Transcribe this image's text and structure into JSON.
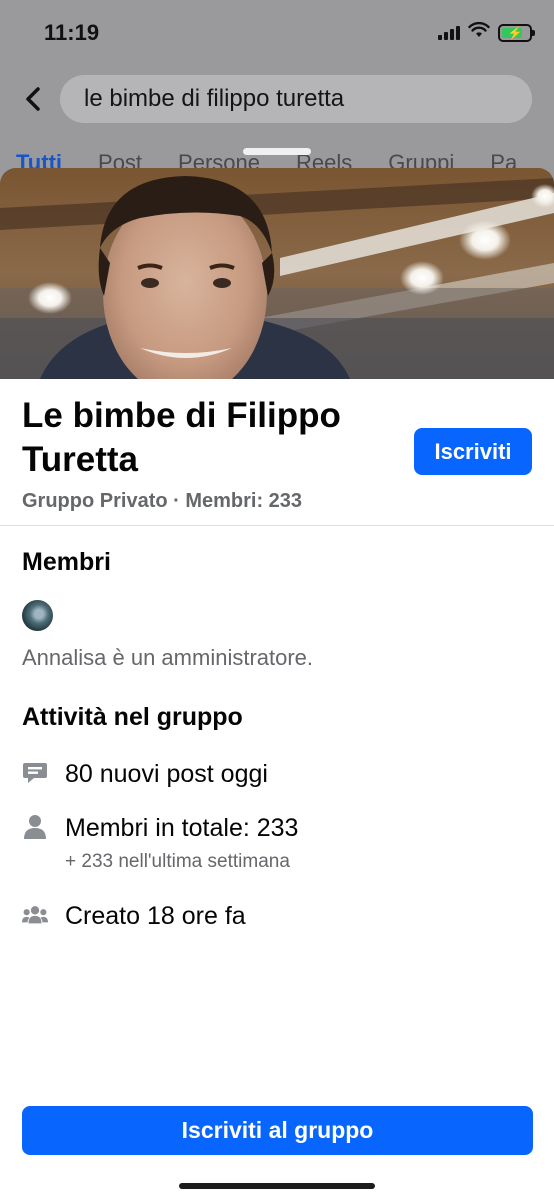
{
  "status": {
    "time": "11:19"
  },
  "search": {
    "query": "le bimbe di filippo turetta"
  },
  "tabs": [
    {
      "label": "Tutti"
    },
    {
      "label": "Post"
    },
    {
      "label": "Persone"
    },
    {
      "label": "Reels"
    },
    {
      "label": "Gruppi"
    },
    {
      "label": "Pa"
    }
  ],
  "group": {
    "name": "Le bimbe di Filippo Turetta",
    "meta": "Gruppo Privato · Membri: 233",
    "join_label": "Iscriviti"
  },
  "members": {
    "heading": "Membri",
    "admin_note": "Annalisa è un amministratore."
  },
  "activity": {
    "heading": "Attività nel gruppo",
    "posts_today": "80 nuovi post oggi",
    "total_members": "Membri in totale: 233",
    "weekly_new": "+ 233 nell'ultima settimana",
    "created": "Creato 18 ore fa"
  },
  "footer": {
    "join_group_label": "Iscriviti al gruppo"
  },
  "colors": {
    "accent": "#0866ff",
    "tab_active": "#1755c9",
    "secondary_text": "#65676b"
  },
  "icons": [
    "chevron-left-icon",
    "cellular-signal-icon",
    "wifi-icon",
    "battery-charging-icon",
    "chat-bubble-icon",
    "person-icon",
    "group-people-icon"
  ]
}
